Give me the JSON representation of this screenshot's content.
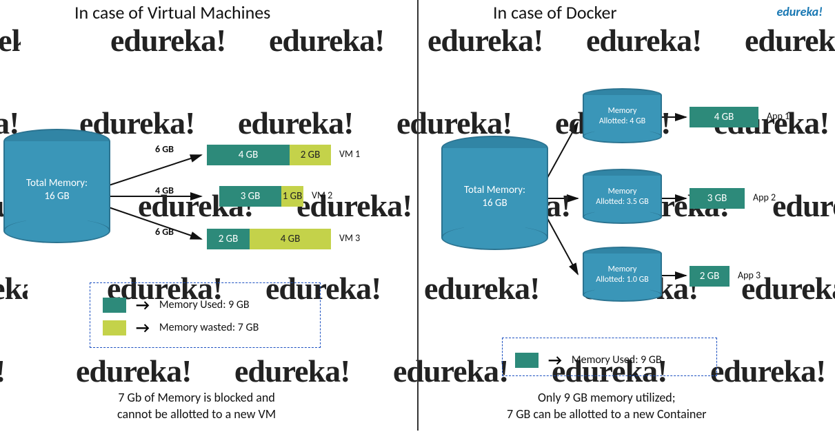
{
  "brand": "edureka!",
  "watermark_text": "edureka!",
  "left": {
    "heading": "In case of Virtual Machines",
    "total_mem_label": "Total Memory:\n16 GB",
    "bars": [
      {
        "alloc_label": "6 GB",
        "used": "4 GB",
        "wasted": "2 GB",
        "name": "VM 1"
      },
      {
        "alloc_label": "4 GB",
        "used": "3 GB",
        "wasted": "1 GB",
        "name": "VM 2"
      },
      {
        "alloc_label": "6 GB",
        "used": "2 GB",
        "wasted": "4 GB",
        "name": "VM 3"
      }
    ],
    "legend_used": "Memory Used: 9 GB",
    "legend_wasted": "Memory wasted: 7 GB",
    "conclusion": "7 Gb of Memory is blocked and\ncannot be allotted to a new VM"
  },
  "right": {
    "heading": "In case of Docker",
    "total_mem_label": "Total Memory:\n16 GB",
    "cyls": [
      {
        "label": "Memory\nAllotted: 4 GB",
        "used": "4 GB",
        "app": "App 1"
      },
      {
        "label": "Memory\nAllotted: 3.5 GB",
        "used": "3 GB",
        "app": "App 2"
      },
      {
        "label": "Memory\nAllotted: 1.0 GB",
        "used": "2 GB",
        "app": "App 3"
      }
    ],
    "legend_used": "Memory Used: 9 GB",
    "conclusion": "Only 9 GB memory utilized;\n7 GB can be allotted to a new Container"
  }
}
